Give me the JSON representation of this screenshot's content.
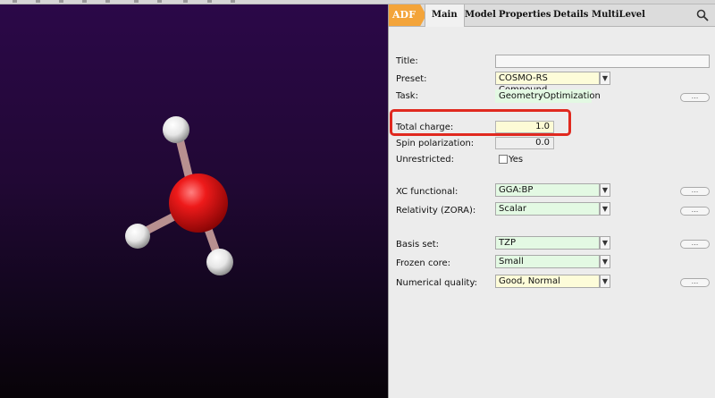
{
  "panel": {
    "tabs": {
      "adf": "ADF",
      "main": "Main",
      "model": "Model",
      "properties": "Properties",
      "details": "Details",
      "multilevel": "MultiLevel"
    },
    "search_icon": "search-icon",
    "fields": {
      "title": {
        "label": "Title:",
        "value": ""
      },
      "preset": {
        "label": "Preset:",
        "value": "COSMO-RS Compound"
      },
      "task": {
        "label": "Task:",
        "value": "GeometryOptimization"
      },
      "total_charge": {
        "label": "Total charge:",
        "value": "1.0"
      },
      "spin_polarization": {
        "label": "Spin polarization:",
        "value": "0.0"
      },
      "unrestricted": {
        "label": "Unrestricted:",
        "option": "Yes",
        "checked": false
      },
      "xc_functional": {
        "label": "XC functional:",
        "value": "GGA:BP"
      },
      "relativity": {
        "label": "Relativity (ZORA):",
        "value": "Scalar"
      },
      "basis_set": {
        "label": "Basis set:",
        "value": "TZP"
      },
      "frozen_core": {
        "label": "Frozen core:",
        "value": "Small"
      },
      "numerical_quality": {
        "label": "Numerical quality:",
        "value": "Good, Normal"
      }
    },
    "more_button": "...",
    "dropdown_arrow": "▼"
  },
  "colors": {
    "adf_tab": "#f3a43a",
    "highlight": "#e0291f",
    "oxygen_atom": "#e01010",
    "hydrogen_atom": "#f2f2f2",
    "viewport_top": "#2b0848",
    "viewport_bottom": "#080308"
  }
}
